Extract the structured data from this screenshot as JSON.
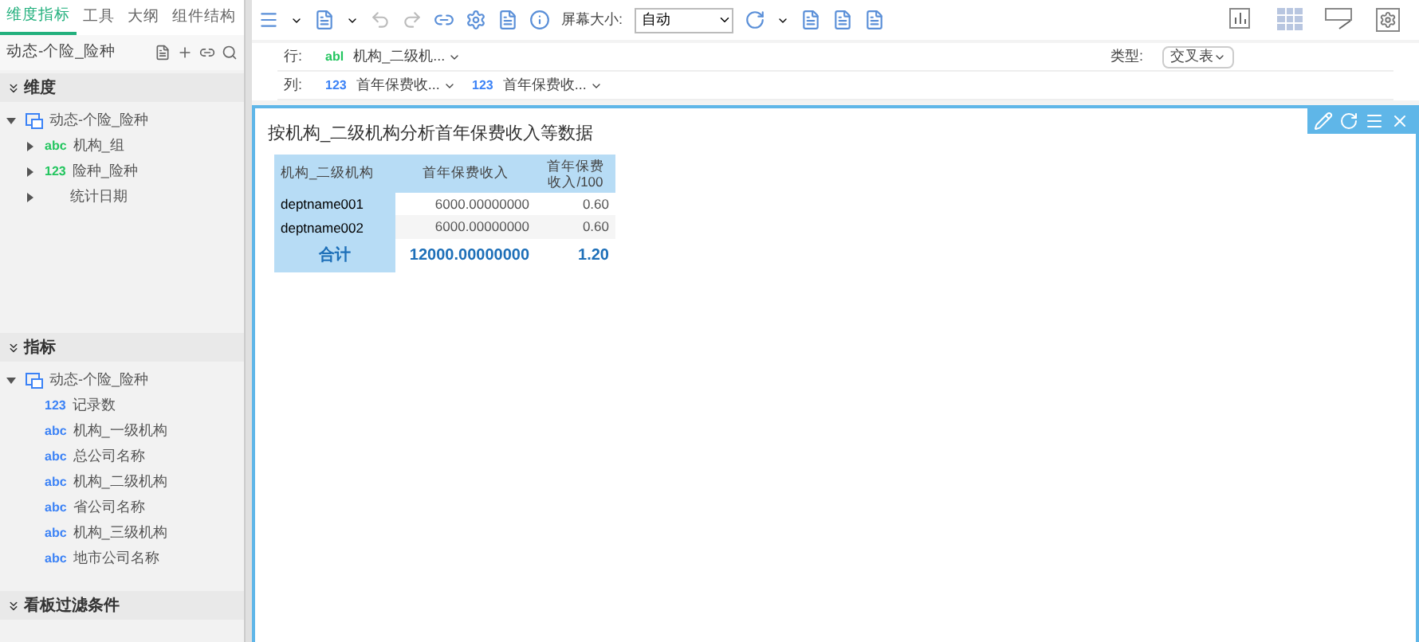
{
  "sidebar": {
    "tabs": [
      {
        "label": "维度指标",
        "selected": true
      },
      {
        "label": "工具",
        "selected": false
      },
      {
        "label": "大纲",
        "selected": false
      },
      {
        "label": "组件结构",
        "selected": false
      }
    ],
    "dataset": "动态-个险_险种",
    "sections": [
      {
        "title": "维度",
        "tree": [
          {
            "label": "动态-个险_险种",
            "expanded": true,
            "children": [
              {
                "label": "机构_组",
                "badge": "abc",
                "color": "#22c55e",
                "expanded": false
              },
              {
                "label": "险种_险种",
                "badge": "123",
                "color": "#22c55e",
                "expanded": false
              },
              {
                "label": "统计日期",
                "expanded": false
              }
            ]
          }
        ]
      },
      {
        "title": "指标",
        "tree": [
          {
            "label": "动态-个险_险种",
            "expanded": true,
            "children": [
              {
                "label": "记录数",
                "badge": "123",
                "color": "#3b82f6"
              },
              {
                "label": "机构_一级机构",
                "badge": "abc",
                "color": "#3b82f6"
              },
              {
                "label": "总公司名称",
                "badge": "abc",
                "color": "#3b82f6"
              },
              {
                "label": "机构_二级机构",
                "badge": "abc",
                "color": "#3b82f6"
              },
              {
                "label": "省公司名称",
                "badge": "abc",
                "color": "#3b82f6"
              },
              {
                "label": "机构_三级机构",
                "badge": "abc",
                "color": "#3b82f6"
              },
              {
                "label": "地市公司名称",
                "badge": "abc",
                "color": "#3b82f6"
              }
            ]
          }
        ]
      },
      {
        "title": "看板过滤条件"
      }
    ]
  },
  "toolbar": {
    "screen_size_label": "屏幕大小:",
    "screen_size": "自动"
  },
  "rows_bar": {
    "label": "行:",
    "fields": [
      {
        "badge": "abl",
        "color": "#22c55e",
        "label": "机构_二级机..."
      }
    ],
    "type_label": "类型:",
    "type_value": "交叉表"
  },
  "cols_bar": {
    "label": "列:",
    "fields": [
      {
        "badge": "123",
        "color": "#3b82f6",
        "label": "首年保费收..."
      },
      {
        "badge": "123",
        "color": "#3b82f6",
        "label": "首年保费收..."
      }
    ]
  },
  "panel": {
    "title": "按机构_二级机构分析首年保费收入等数据",
    "table": {
      "columns": [
        "机构_二级机构",
        "首年保费收入",
        "首年保费收入/100"
      ],
      "rows": [
        [
          "deptname001",
          "6000.00000000",
          "0.60"
        ],
        [
          "deptname002",
          "6000.00000000",
          "0.60"
        ]
      ],
      "total": [
        "合计",
        "12000.00000000",
        "1.20"
      ]
    }
  }
}
